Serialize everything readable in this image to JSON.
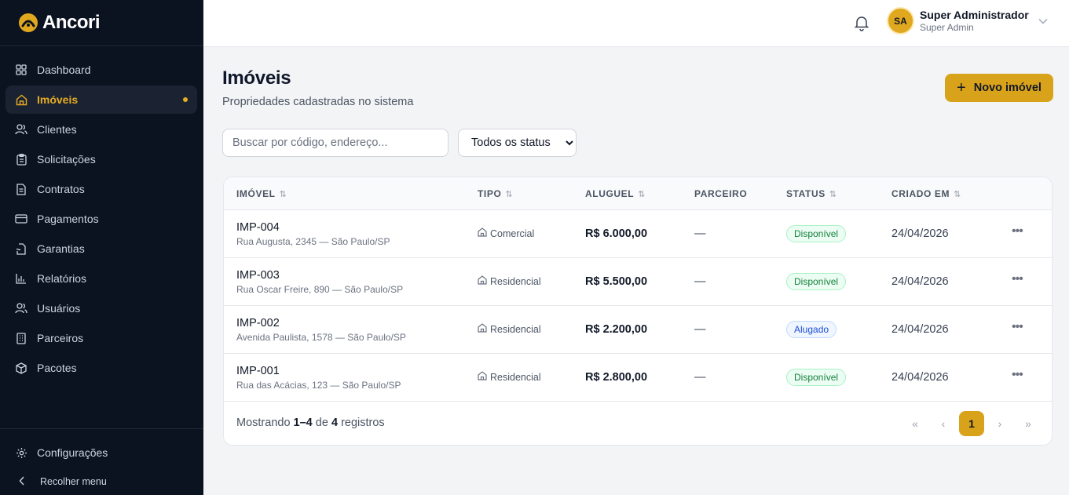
{
  "brand": {
    "name": "Ancori",
    "accent": "#d9a21b",
    "sidebar_bg": "#0b1220"
  },
  "sidebar": {
    "items": [
      {
        "label": "Dashboard",
        "icon": "grid-icon"
      },
      {
        "label": "Imóveis",
        "icon": "home-icon",
        "active": true
      },
      {
        "label": "Clientes",
        "icon": "users-icon"
      },
      {
        "label": "Solicitações",
        "icon": "clipboard-icon"
      },
      {
        "label": "Contratos",
        "icon": "file-icon"
      },
      {
        "label": "Pagamentos",
        "icon": "credit-card-icon"
      },
      {
        "label": "Garantias",
        "icon": "file-signature-icon"
      },
      {
        "label": "Relatórios",
        "icon": "bar-chart-icon"
      },
      {
        "label": "Usuários",
        "icon": "users-icon"
      },
      {
        "label": "Parceiros",
        "icon": "building-icon"
      },
      {
        "label": "Pacotes",
        "icon": "package-icon"
      }
    ],
    "settings_label": "Configurações",
    "collapse_label": "Recolher menu"
  },
  "header": {
    "user": {
      "initials": "SA",
      "name": "Super Administrador",
      "role": "Super Admin"
    }
  },
  "page": {
    "title": "Imóveis",
    "subtitle": "Propriedades cadastradas no sistema",
    "new_button": "Novo imóvel",
    "search_placeholder": "Buscar por código, endereço...",
    "status_filter": "Todos os status"
  },
  "table": {
    "columns": [
      "IMÓVEL",
      "TIPO",
      "ALUGUEL",
      "PARCEIRO",
      "STATUS",
      "CRIADO EM"
    ],
    "rows": [
      {
        "code": "IMP-004",
        "address": "Rua Augusta, 2345 — São Paulo/SP",
        "tipo": "Comercial",
        "aluguel": "R$ 6.000,00",
        "parceiro": "—",
        "status": "Disponível",
        "status_kind": "disp",
        "criado": "24/04/2026"
      },
      {
        "code": "IMP-003",
        "address": "Rua Oscar Freire, 890 — São Paulo/SP",
        "tipo": "Residencial",
        "aluguel": "R$ 5.500,00",
        "parceiro": "—",
        "status": "Disponível",
        "status_kind": "disp",
        "criado": "24/04/2026"
      },
      {
        "code": "IMP-002",
        "address": "Avenida Paulista, 1578 — São Paulo/SP",
        "tipo": "Residencial",
        "aluguel": "R$ 2.200,00",
        "parceiro": "—",
        "status": "Alugado",
        "status_kind": "alug",
        "criado": "24/04/2026"
      },
      {
        "code": "IMP-001",
        "address": "Rua das Acácias, 123 — São Paulo/SP",
        "tipo": "Residencial",
        "aluguel": "R$ 2.800,00",
        "parceiro": "—",
        "status": "Disponível",
        "status_kind": "disp",
        "criado": "24/04/2026"
      }
    ]
  },
  "footer": {
    "showing_prefix": "Mostrando",
    "range": "1–4",
    "of": "de",
    "total": "4",
    "suffix": "registros",
    "current_page": "1"
  }
}
